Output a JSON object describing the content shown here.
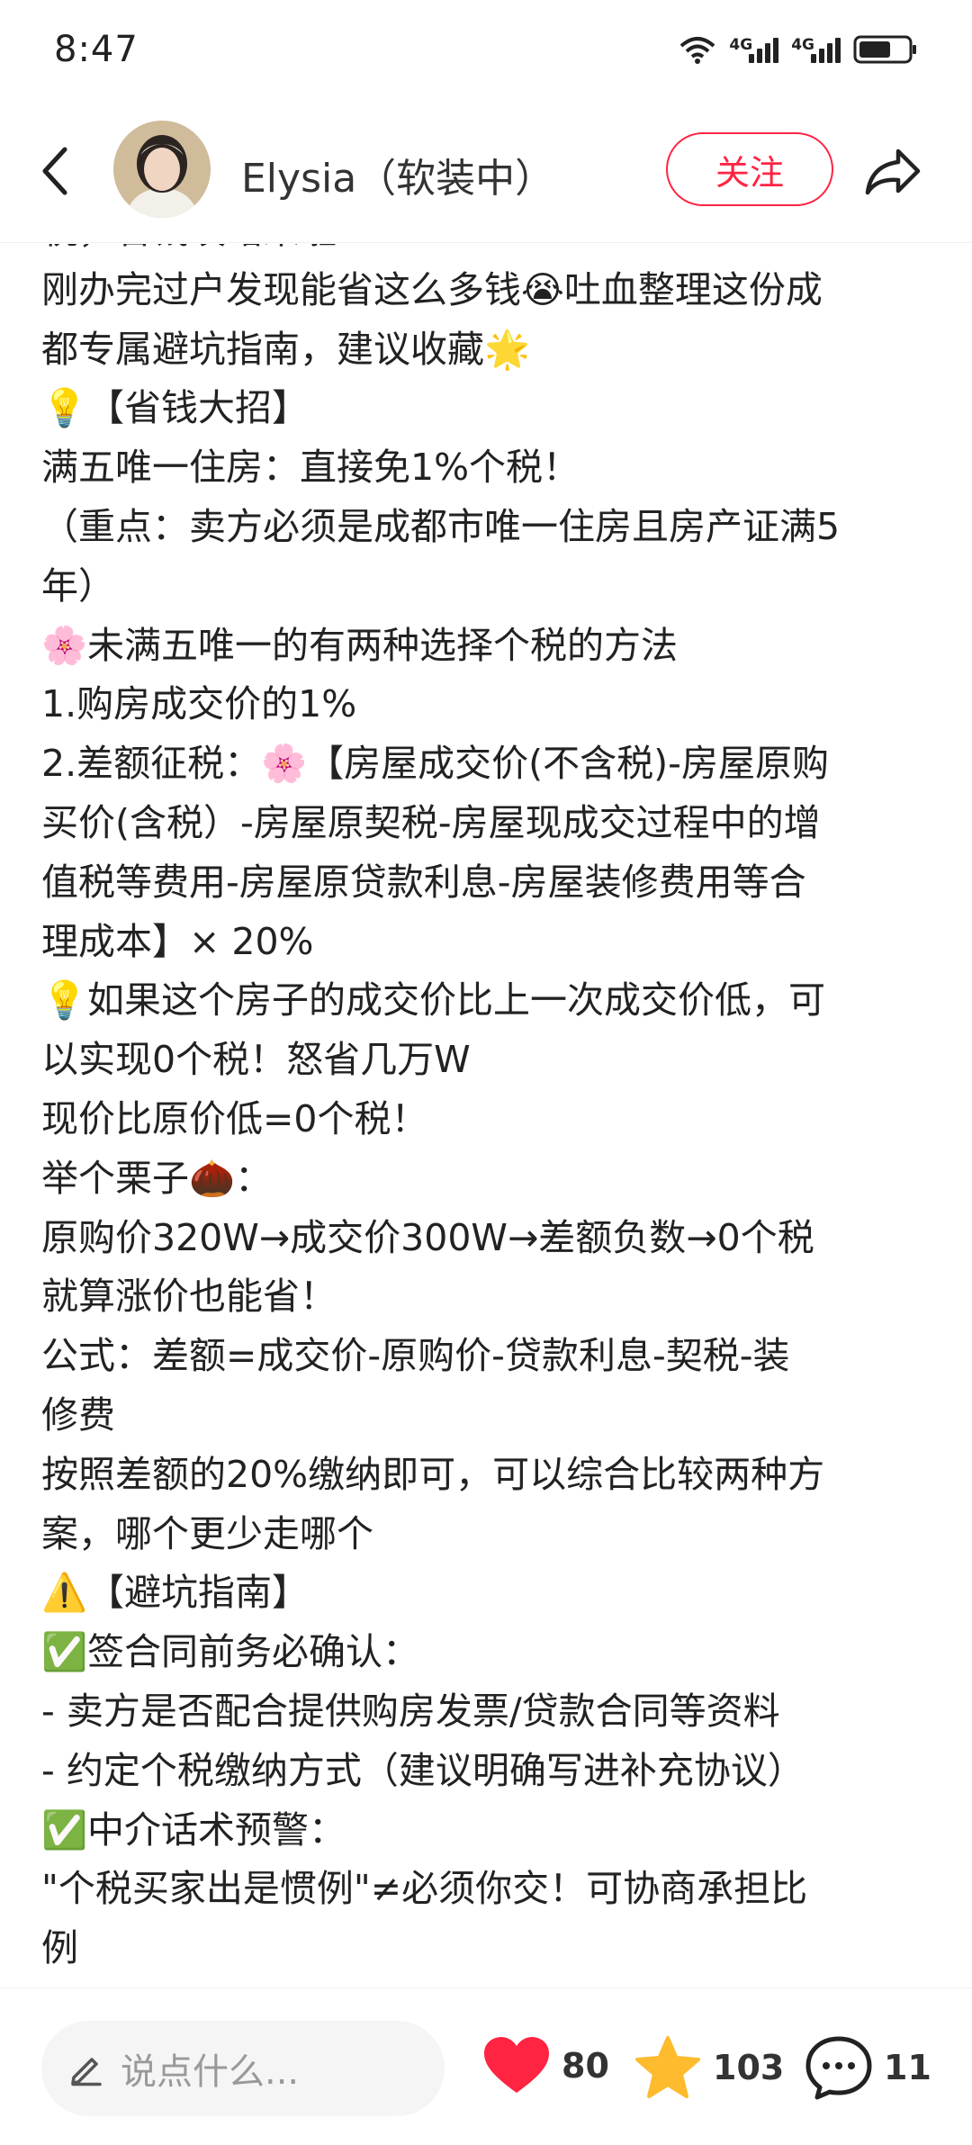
{
  "status_bar": {
    "time": "8:47",
    "network_1": "4G",
    "network_2": "4G",
    "icons": [
      "wifi-icon",
      "signal-icon",
      "signal-icon",
      "battery-icon"
    ]
  },
  "header": {
    "author_name": "Elysia（软装中）",
    "follow_label": "关注"
  },
  "post": {
    "lines": [
      "税，省钱攻略来啦！",
      "刚办完过户发现能省这么多钱😭吐血整理这份成",
      "都专属避坑指南，建议收藏🌟",
      "💡【省钱大招】",
      "满五唯一住房：直接免1%个税！",
      "（重点：卖方必须是成都市唯一住房且房产证满5",
      "年）",
      "🌸未满五唯一的有两种选择个税的方法",
      "1.购房成交价的1%",
      "2.差额征税：🌸【房屋成交价(不含税)-房屋原购",
      "买价(含税）-房屋原契税-房屋现成交过程中的增",
      "值税等费用-房屋原贷款利息-房屋装修费用等合",
      "理成本】× 20%",
      "💡如果这个房子的成交价比上一次成交价低，可",
      "以实现0个税！怒省几万W",
      "现价比原价低=0个税！",
      "举个栗子🌰：",
      "原购价320W→成交价300W→差额负数→0个税",
      "就算涨价也能省！",
      "公式：差额=成交价-原购价-贷款利息-契税-装",
      "修费",
      "按照差额的20%缴纳即可，可以综合比较两种方",
      "案，哪个更少走哪个",
      "⚠️【避坑指南】",
      "✅签合同前务必确认：",
      "- 卖方是否配合提供购房发票/贷款合同等资料",
      "- 约定个税缴纳方式（建议明确写进补充协议）",
      "✅中介话术预警：",
      "\"个税买家出是惯例\"≠必须你交！可协商承担比",
      "例"
    ]
  },
  "bottom_bar": {
    "comment_placeholder": "说点什么...",
    "likes": "80",
    "collects": "103",
    "comments": "11"
  },
  "colors": {
    "accent": "#ff2442",
    "like": "#ff2442",
    "collect": "#fdbb2d"
  }
}
